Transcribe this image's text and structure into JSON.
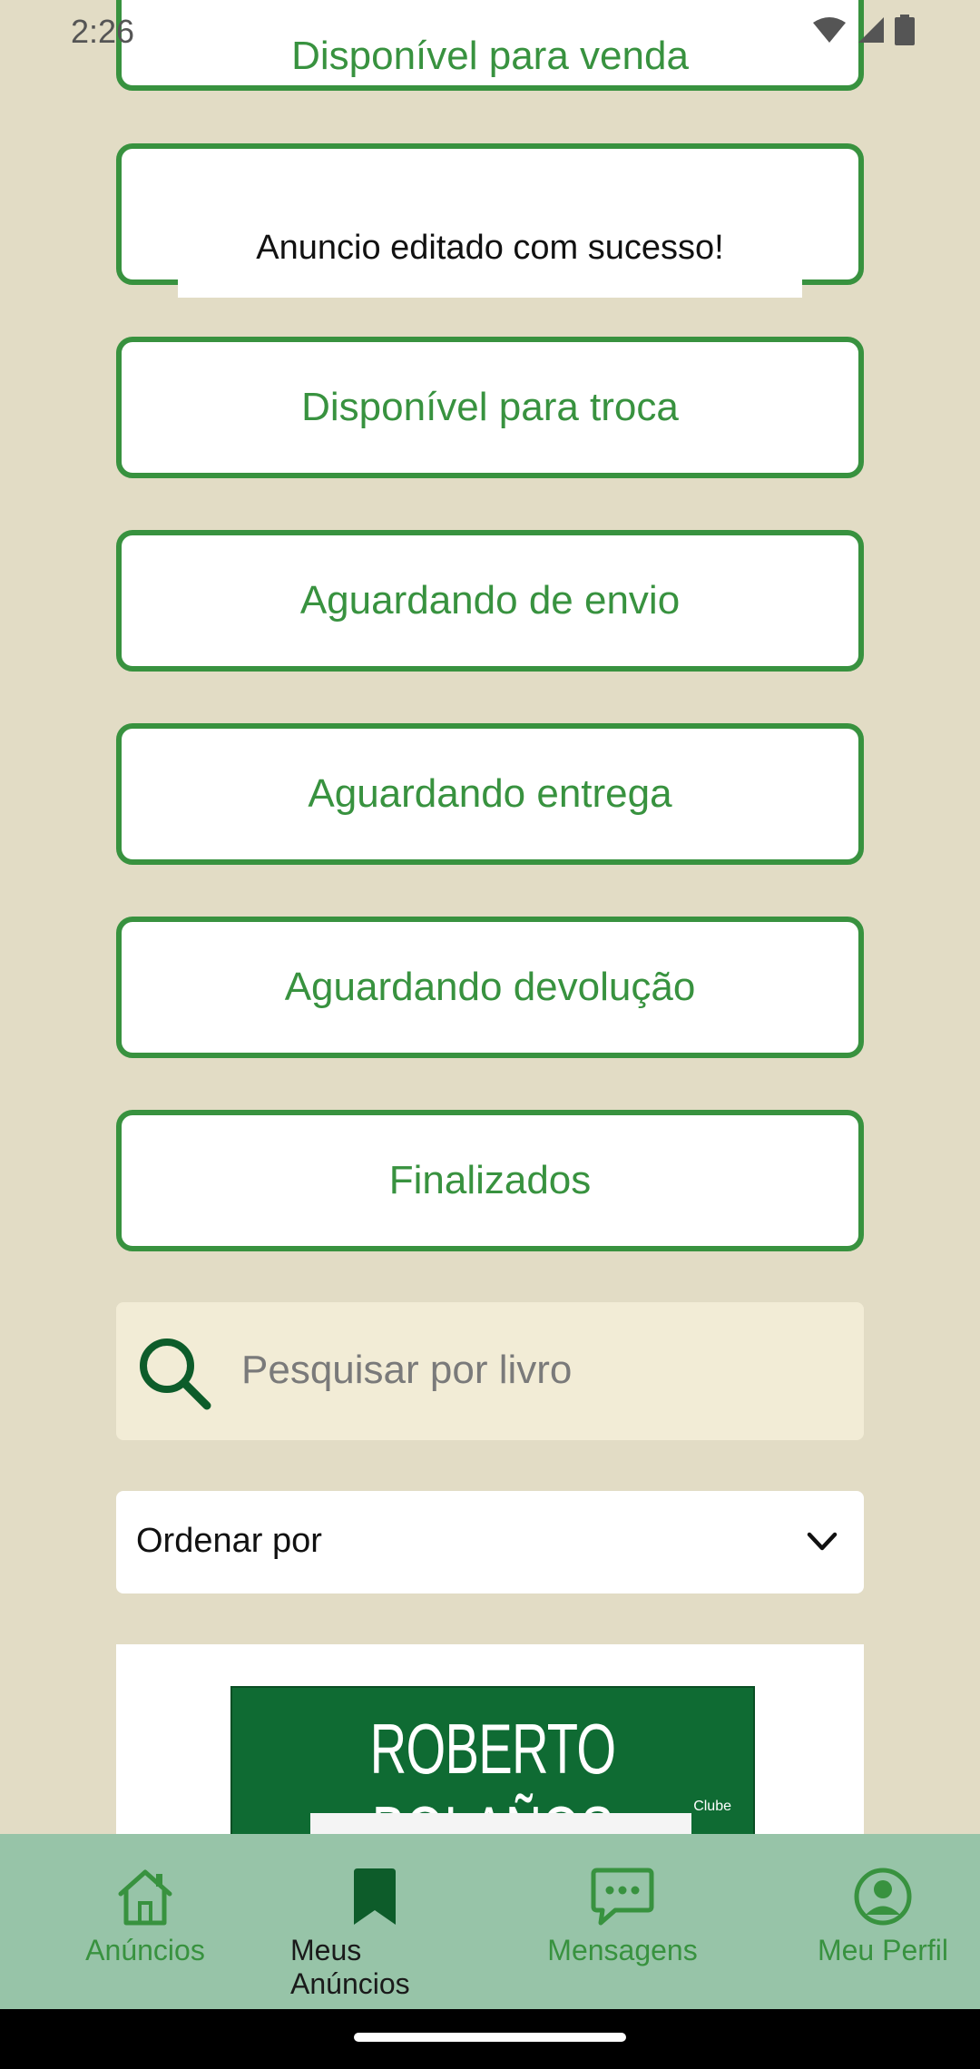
{
  "status_bar": {
    "time": "2:26"
  },
  "filters": [
    {
      "label": "Disponível para venda"
    },
    {
      "label": ""
    },
    {
      "label": "Disponível para troca"
    },
    {
      "label": "Aguardando de envio"
    },
    {
      "label": "Aguardando entrega"
    },
    {
      "label": "Aguardando devolução"
    },
    {
      "label": "Finalizados"
    }
  ],
  "toast": {
    "message": "Anuncio editado com sucesso!"
  },
  "search": {
    "placeholder": "Pesquisar por livro",
    "icon": "search-icon"
  },
  "sort": {
    "label": "Ordenar por",
    "icon": "chevron-down-icon"
  },
  "book": {
    "cover_title": "ROBERTO BOLAÑOS",
    "cover_logo": "Clube"
  },
  "bottom_nav": {
    "items": [
      {
        "label": "Anúncios",
        "icon": "home-icon",
        "active": false
      },
      {
        "label": "Meus Anúncios",
        "icon": "bookmark-icon",
        "active": true
      },
      {
        "label": "Mensagens",
        "icon": "chat-icon",
        "active": false
      },
      {
        "label": "Meu Perfil",
        "icon": "profile-icon",
        "active": false
      }
    ]
  },
  "colors": {
    "accent": "#38923f",
    "background": "#e2dcc5",
    "nav_bg": "#97c4a8"
  }
}
